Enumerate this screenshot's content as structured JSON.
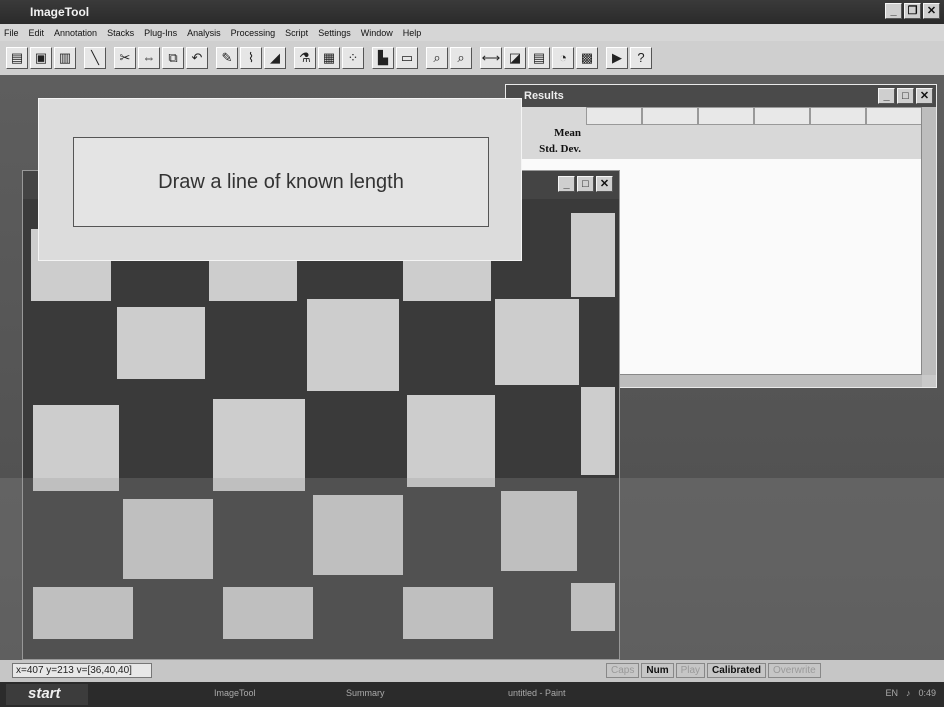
{
  "app": {
    "title": "ImageTool"
  },
  "menu": [
    "File",
    "Edit",
    "Annotation",
    "Stacks",
    "Plug-Ins",
    "Analysis",
    "Processing",
    "Script",
    "Settings",
    "Window",
    "Help"
  ],
  "results": {
    "title": "Results",
    "row_labels": [
      "Mean",
      "Std. Dev."
    ]
  },
  "dialog": {
    "message": "Draw a line of known length"
  },
  "statusbar": {
    "coords": "x=407 y=213 v=[36,40,40]",
    "flags": [
      {
        "label": "Caps",
        "active": false
      },
      {
        "label": "Num",
        "active": true
      },
      {
        "label": "Play",
        "active": false
      },
      {
        "label": "Calibrated",
        "active": true
      },
      {
        "label": "Overwrite",
        "active": false
      }
    ]
  },
  "taskbar": {
    "start": "start",
    "tasks": [
      "ImageTool",
      "Summary",
      "untitled - Paint"
    ],
    "tray": {
      "lang": "EN",
      "time": "0:49"
    }
  }
}
